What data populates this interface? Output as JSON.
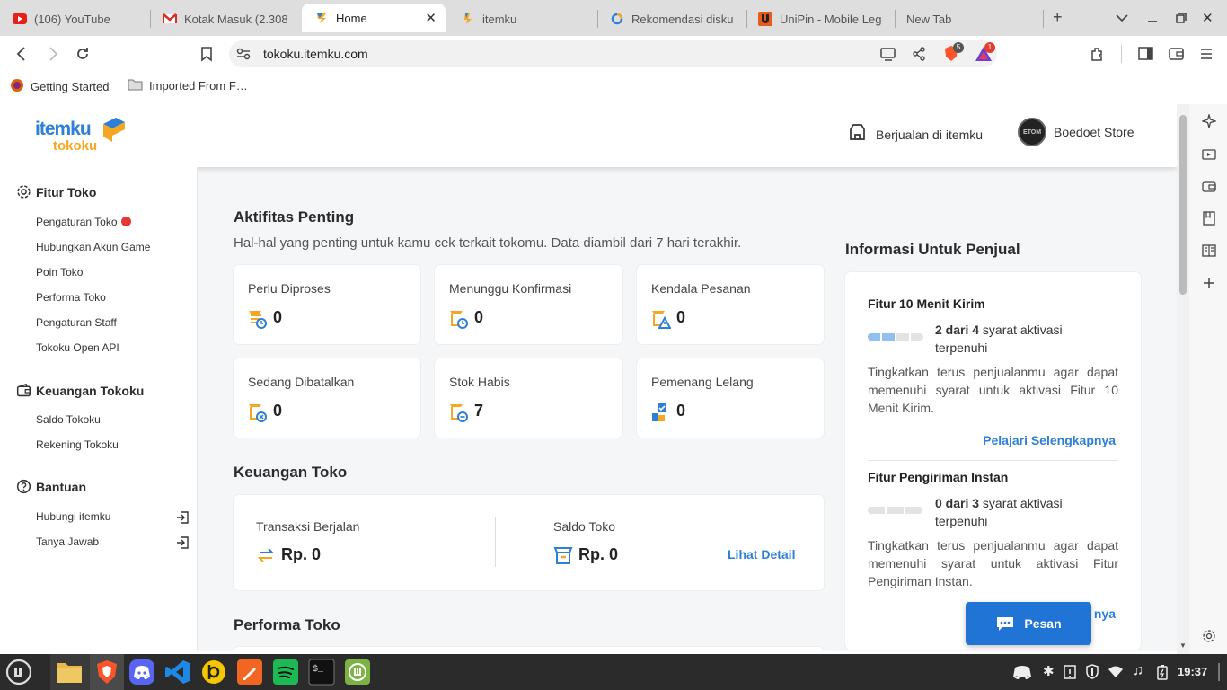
{
  "browser": {
    "tabs": [
      {
        "label": "(106) YouTube",
        "icon": "youtube-icon"
      },
      {
        "label": "Kotak Masuk (2.308",
        "icon": "gmail-icon"
      },
      {
        "label": "Home",
        "icon": "itemku-icon",
        "active": true
      },
      {
        "label": "itemku",
        "icon": "itemku-icon"
      },
      {
        "label": "Rekomendasi disku",
        "icon": "globe-icon"
      },
      {
        "label": "UniPin - Mobile Leg",
        "icon": "unipin-icon"
      },
      {
        "label": "New Tab",
        "icon": ""
      }
    ],
    "url": "tokoku.itemku.com",
    "shield_badge": "5",
    "alert_badge": "1",
    "bookmarks": [
      {
        "label": "Getting Started",
        "icon": "firefox-icon"
      },
      {
        "label": "Imported From F…",
        "icon": "folder-icon"
      }
    ]
  },
  "header": {
    "logo_top": "itemku",
    "logo_bottom": "tokoku",
    "sell_link": "Berjualan di itemku",
    "store_name": "Boedoet Store",
    "avatar_text": "ETOM"
  },
  "sidebar": {
    "fitur": {
      "title": "Fitur Toko",
      "items": [
        "Pengaturan Toko",
        "Hubungkan Akun Game",
        "Poin Toko",
        "Performa Toko",
        "Pengaturan Staff",
        "Tokoku Open API"
      ]
    },
    "keuangan": {
      "title": "Keuangan Tokoku",
      "items": [
        "Saldo Tokoku",
        "Rekening Tokoku"
      ]
    },
    "bantuan": {
      "title": "Bantuan",
      "items": [
        "Hubungi itemku",
        "Tanya Jawab"
      ]
    }
  },
  "aktifitas": {
    "title": "Aktifitas Penting",
    "subtitle": "Hal-hal yang penting untuk kamu cek terkait tokomu. Data diambil dari 7 hari terakhir.",
    "cards": [
      {
        "label": "Perlu Diproses",
        "value": "0"
      },
      {
        "label": "Menunggu Konfirmasi",
        "value": "0"
      },
      {
        "label": "Kendala Pesanan",
        "value": "0"
      },
      {
        "label": "Sedang Dibatalkan",
        "value": "0"
      },
      {
        "label": "Stok Habis",
        "value": "7"
      },
      {
        "label": "Pemenang Lelang",
        "value": "0"
      }
    ]
  },
  "keuangan_toko": {
    "title": "Keuangan Toko",
    "transaksi_label": "Transaksi Berjalan",
    "transaksi_value": "Rp. 0",
    "saldo_label": "Saldo Toko",
    "saldo_value": "Rp. 0",
    "detail_link": "Lihat Detail"
  },
  "performa": {
    "title": "Performa Toko"
  },
  "info": {
    "title": "Informasi Untuk Penjual",
    "items": [
      {
        "title": "Fitur 10 Menit Kirim",
        "progress_bold": "2 dari 4",
        "progress_rest": " syarat aktivasi",
        "progress_line2": "terpenuhi",
        "progress_done": 2,
        "progress_total": 4,
        "desc": "Tingkatkan terus penjualanmu agar dapat memenuhi syarat untuk aktivasi Fitur 10 Menit Kirim.",
        "link": "Pelajari Selengkapnya"
      },
      {
        "title": "Fitur Pengiriman Instan",
        "progress_bold": "0 dari 3",
        "progress_rest": " syarat aktivasi",
        "progress_line2": "terpenuhi",
        "progress_done": 0,
        "progress_total": 3,
        "desc": "Tingkatkan terus penjualanmu agar dapat memenuhi syarat untuk aktivasi Fitur Pengiriman Instan.",
        "link": "nya"
      }
    ]
  },
  "chat_button": "Pesan",
  "taskbar": {
    "clock": "19:37"
  },
  "colors": {
    "brand_blue": "#2d7fd8",
    "brand_yellow": "#f5a623",
    "chat_blue": "#1f74d6"
  }
}
